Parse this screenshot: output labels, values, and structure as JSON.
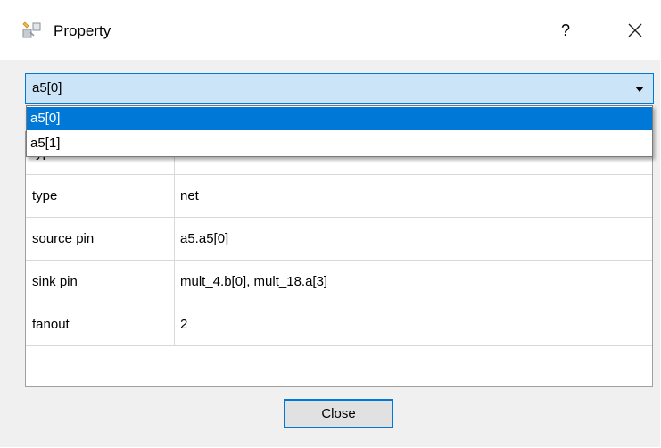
{
  "window": {
    "title": "Property",
    "help_label": "?",
    "close_icon": "close-icon",
    "app_icon": "property-icon"
  },
  "combo": {
    "selected": "a5[0]",
    "options": [
      "a5[0]",
      "a5[1]"
    ]
  },
  "properties": [
    {
      "key": "type",
      "value": "net"
    },
    {
      "key": "source pin",
      "value": "a5.a5[0]"
    },
    {
      "key": "sink pin",
      "value": "mult_4.b[0], mult_18.a[3]"
    },
    {
      "key": "fanout",
      "value": "2"
    }
  ],
  "buttons": {
    "close": "Close"
  },
  "colors": {
    "accent": "#0078d7",
    "combo_bg": "#cce4f7",
    "dialog_bg": "#f0f0f0"
  }
}
